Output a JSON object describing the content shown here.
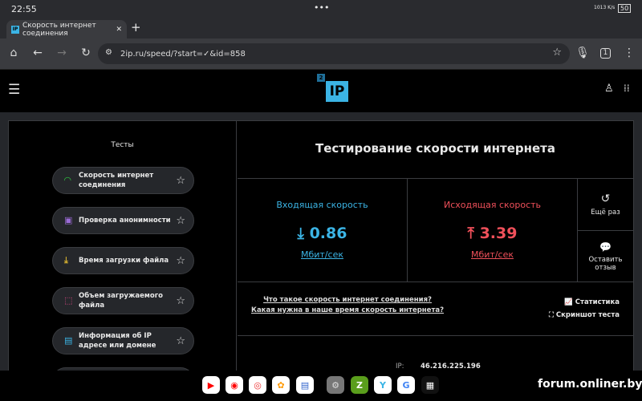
{
  "status": {
    "time": "22:55",
    "dots": "•••",
    "net_speed": "1013 K/s",
    "battery": "50"
  },
  "tab": {
    "title": "Скорость интернет соединения",
    "favicon": "IP",
    "close": "✕",
    "new_tab": "+"
  },
  "toolbar": {
    "url": "2ip.ru/speed/?start=✓&id=858",
    "tab_count": "1"
  },
  "header": {
    "logo": "IP",
    "logo_badge": "2"
  },
  "sidebar": {
    "title": "Тесты",
    "items": [
      {
        "label": "Скорость интернет соединения",
        "icon": "speedometer-icon",
        "color": "#2ecc40"
      },
      {
        "label": "Проверка анонимности",
        "icon": "lock-window-icon",
        "color": "#9b6bd6"
      },
      {
        "label": "Время загрузки файла",
        "icon": "download-tray-icon",
        "color": "#d6b030"
      },
      {
        "label": "Объем загружаемого файла",
        "icon": "resize-icon",
        "color": "#e54a8a"
      },
      {
        "label": "Информация об IP адресе или домене",
        "icon": "document-icon",
        "color": "#3bb4e5"
      }
    ]
  },
  "main": {
    "title": "Тестирование скорости интернета",
    "download": {
      "label": "Входящая скорость",
      "value": "0.86",
      "unit": "Мбит/сек",
      "color": "#3bb4e5"
    },
    "upload": {
      "label": "Исходящая скорость",
      "value": "3.39",
      "unit": "Мбит/сек",
      "color": "#f0505a"
    },
    "again": "Ещё раз",
    "feedback": "Оставить отзыв",
    "links": [
      "Что такое скорость интернет соединения?",
      "Какая нужна в наше время скорость интернета?"
    ],
    "stats": "Статистика",
    "screenshot": "Скриншот теста",
    "ip_label": "IP:",
    "ip": "46.216.225.196"
  },
  "watermark": "forum.onliner.by"
}
